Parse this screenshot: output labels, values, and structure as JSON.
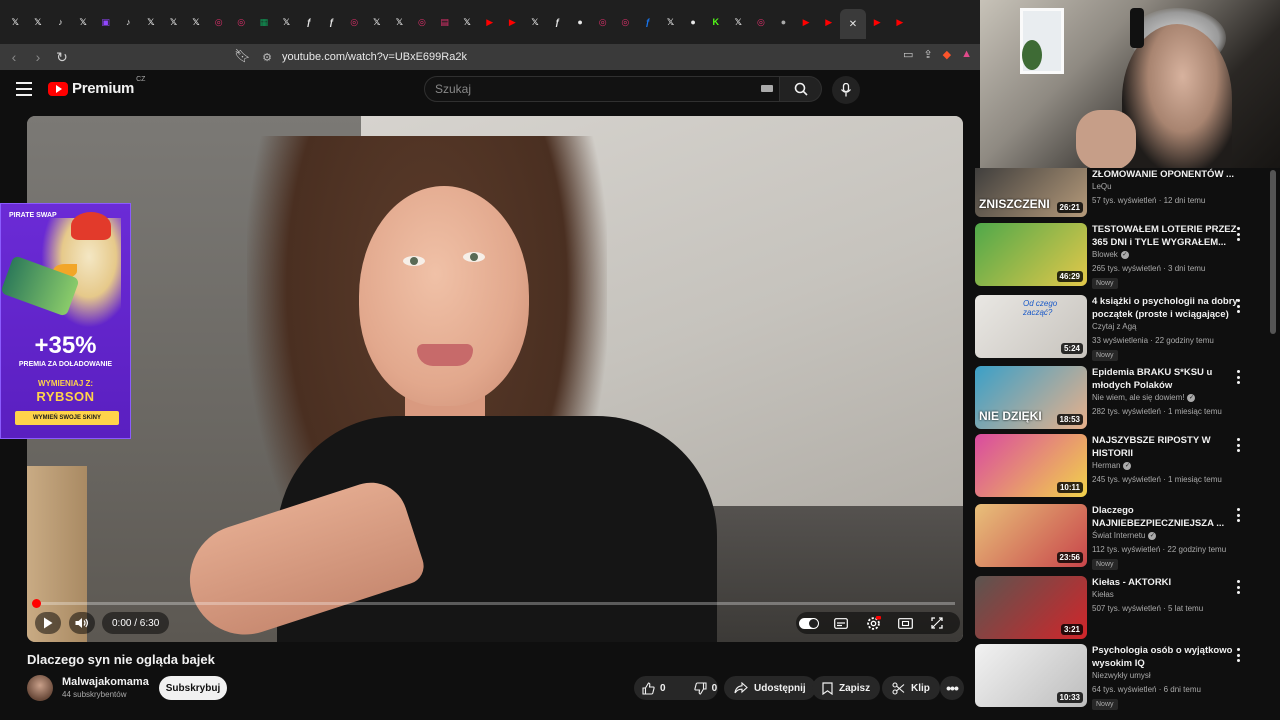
{
  "browser": {
    "tabs": [
      {
        "glyph": "𝕏",
        "color": "#e8e8e8"
      },
      {
        "glyph": "𝕏",
        "color": "#e8e8e8"
      },
      {
        "glyph": "♪",
        "color": "#e8e8e8"
      },
      {
        "glyph": "𝕏",
        "color": "#e8e8e8"
      },
      {
        "glyph": "▣",
        "color": "#9146ff"
      },
      {
        "glyph": "♪",
        "color": "#e8e8e8"
      },
      {
        "glyph": "𝕏",
        "color": "#e8e8e8"
      },
      {
        "glyph": "𝕏",
        "color": "#e8e8e8"
      },
      {
        "glyph": "𝕏",
        "color": "#e8e8e8"
      },
      {
        "glyph": "◎",
        "color": "#e1306c"
      },
      {
        "glyph": "◎",
        "color": "#e1306c"
      },
      {
        "glyph": "▦",
        "color": "#0f9d58"
      },
      {
        "glyph": "𝕏",
        "color": "#e8e8e8"
      },
      {
        "glyph": "ƒ",
        "color": "#e8e8e8"
      },
      {
        "glyph": "ƒ",
        "color": "#e8e8e8"
      },
      {
        "glyph": "◎",
        "color": "#e1306c"
      },
      {
        "glyph": "𝕏",
        "color": "#e8e8e8"
      },
      {
        "glyph": "𝕏",
        "color": "#e8e8e8"
      },
      {
        "glyph": "◎",
        "color": "#e1306c"
      },
      {
        "glyph": "▤",
        "color": "#e1306c"
      },
      {
        "glyph": "𝕏",
        "color": "#e8e8e8"
      },
      {
        "glyph": "▶",
        "color": "#ff0000"
      },
      {
        "glyph": "▶",
        "color": "#ff0000"
      },
      {
        "glyph": "𝕏",
        "color": "#e8e8e8"
      },
      {
        "glyph": "ƒ",
        "color": "#e8e8e8"
      },
      {
        "glyph": "●",
        "color": "#e8e8e8"
      },
      {
        "glyph": "◎",
        "color": "#e1306c"
      },
      {
        "glyph": "◎",
        "color": "#e1306c"
      },
      {
        "glyph": "ƒ",
        "color": "#1877f2"
      },
      {
        "glyph": "𝕏",
        "color": "#e8e8e8"
      },
      {
        "glyph": "●",
        "color": "#e8e8e8"
      },
      {
        "glyph": "K",
        "color": "#53fc18"
      },
      {
        "glyph": "𝕏",
        "color": "#e8e8e8"
      },
      {
        "glyph": "◎",
        "color": "#e1306c"
      },
      {
        "glyph": "●",
        "color": "#aaaaaa"
      },
      {
        "glyph": "▶",
        "color": "#ff0000"
      },
      {
        "glyph": "▶",
        "color": "#ff0000"
      },
      {
        "glyph": "▶",
        "color": "#ff0000"
      },
      {
        "glyph": "▶",
        "color": "#ff0000"
      }
    ],
    "active_tab_close": "✕",
    "url": "youtube.com/watch?v=UBxE699Ra2k"
  },
  "yt": {
    "logo_text": "Premium",
    "logo_region": "CZ",
    "search_placeholder": "Szukaj",
    "brand_red": "#ff0000"
  },
  "ad": {
    "brand": "PIRATE SWAP",
    "percent": "+35%",
    "subtitle": "PREMIA ZA DOŁADOWANIE",
    "swap_label": "WYMIENIAJ Z:",
    "swap_name": "RYBSON",
    "cta": "WYMIEŃ SWOJE SKINY"
  },
  "player": {
    "time_display": "0:00 / 6:30",
    "progress_fraction": 0.0
  },
  "video": {
    "title": "Dlaczego syn nie ogląda bajek",
    "channel": "Malwajakomama",
    "subscribers": "44 subskrybentów",
    "subscribe_label": "Subskrybuj",
    "likes": "0",
    "dislikes": "0",
    "share_label": "Udostępnij",
    "save_label": "Zapisz",
    "clip_label": "Klip"
  },
  "recommendations": [
    {
      "title": "ZŁOMOWANIE OPONENTÓW ...",
      "channel": "LeQu",
      "verified": false,
      "meta": "57 tys. wyświetleń · 12 dni temu",
      "duration": "26:21",
      "badge": "",
      "thumb_text": "ZNISZCZENI",
      "thumb_colors": [
        "#3a3a3a",
        "#b59a7a"
      ]
    },
    {
      "title": "TESTOWAŁEM LOTERIE PRZEZ 365 DNI i TYLE WYGRAŁEM...",
      "channel": "Blowek",
      "verified": true,
      "meta": "265 tys. wyświetleń · 3 dni temu",
      "duration": "46:29",
      "badge": "Nowy",
      "thumb_text": "",
      "thumb_colors": [
        "#4fa84a",
        "#e3c84a"
      ]
    },
    {
      "title": "4 książki o psychologii na dobry początek (proste i wciągające)",
      "channel": "Czytaj z Agą",
      "verified": false,
      "meta": "33 wyświetlenia · 22 godziny temu",
      "duration": "5:24",
      "badge": "Nowy",
      "thumb_text": "Od czego zacząć?",
      "thumb_colors": [
        "#e9e7e3",
        "#c7c3bd"
      ]
    },
    {
      "title": "Epidemia BRAKU S*KSU u młodych Polaków",
      "channel": "Nie wiem, ale się dowiem!",
      "verified": true,
      "meta": "282 tys. wyświetleń · 1 miesiąc temu",
      "duration": "18:53",
      "badge": "",
      "thumb_text": "NIE DZIĘKI",
      "thumb_colors": [
        "#3aa0c8",
        "#e9b08a"
      ]
    },
    {
      "title": "NAJSZYBSZE RIPOSTY W HISTORII",
      "channel": "Herman",
      "verified": true,
      "meta": "245 tys. wyświetleń · 1 miesiąc temu",
      "duration": "10:11",
      "badge": "",
      "thumb_text": "",
      "thumb_colors": [
        "#d94aa0",
        "#f2d24a"
      ]
    },
    {
      "title": "Dlaczego NAJNIEBEZPIECZNIEJSZA ...",
      "channel": "Świat Internetu",
      "verified": true,
      "meta": "112 tys. wyświetleń · 22 godziny temu",
      "duration": "23:56",
      "badge": "Nowy",
      "thumb_text": "",
      "thumb_colors": [
        "#e8c07a",
        "#c8454a"
      ]
    },
    {
      "title": "Kiełas - AKTORKI",
      "channel": "Kiełas",
      "verified": false,
      "meta": "507 tys. wyświetleń · 5 lat temu",
      "duration": "3:21",
      "badge": "",
      "thumb_text": "",
      "thumb_colors": [
        "#5a5550",
        "#d2252a"
      ]
    },
    {
      "title": "Psychologia osób o wyjątkowo wysokim IQ",
      "channel": "Niezwykły umysł",
      "verified": false,
      "meta": "64 tys. wyświetleń · 6 dni temu",
      "duration": "10:33",
      "badge": "Nowy",
      "thumb_text": "",
      "thumb_colors": [
        "#f2f2f2",
        "#bdbdbd"
      ]
    }
  ]
}
